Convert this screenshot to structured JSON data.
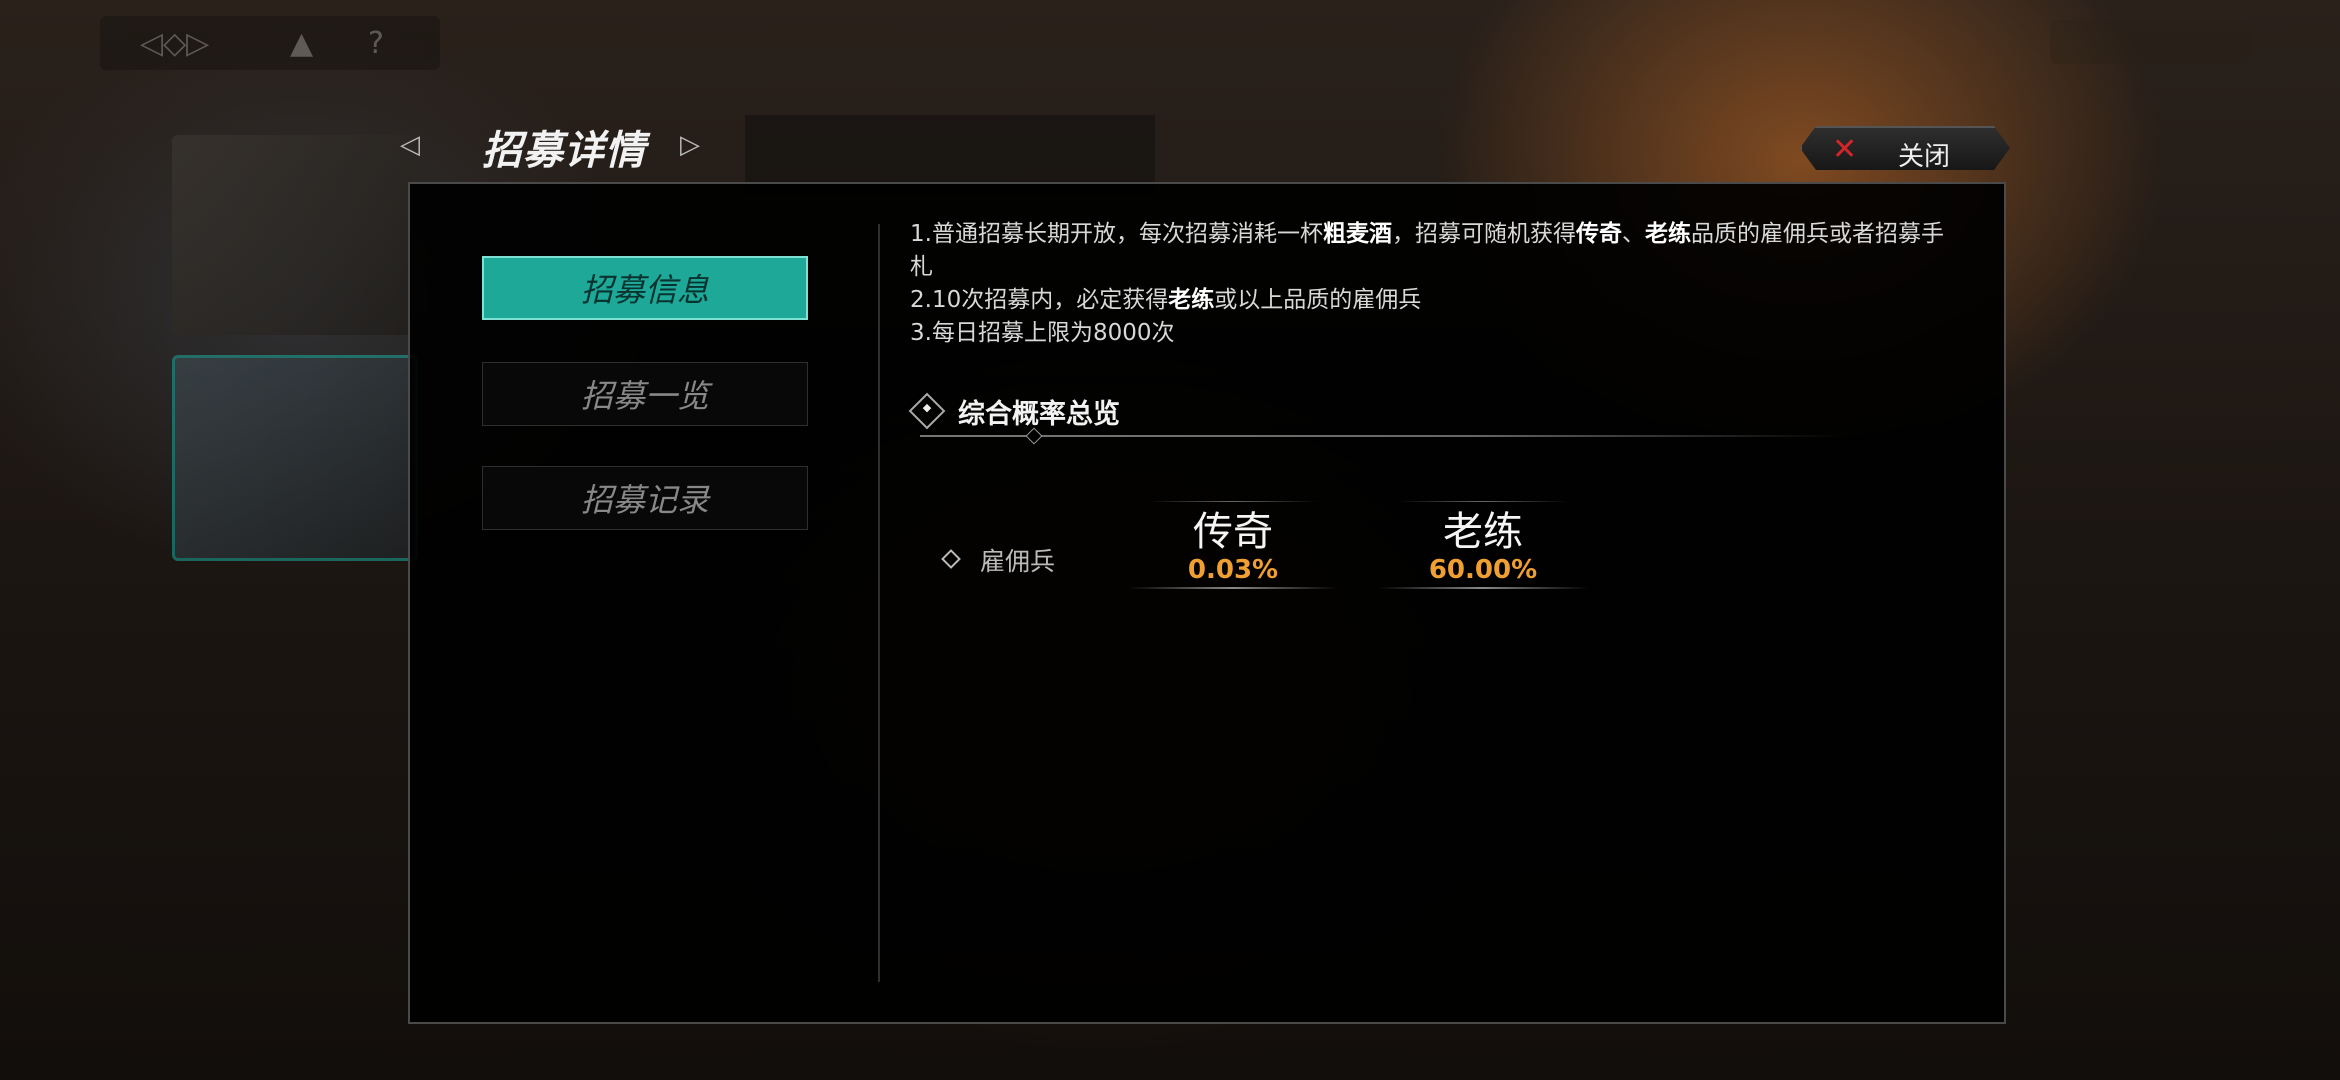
{
  "header": {
    "title": "招募详情",
    "close_label": "关闭"
  },
  "sidebar": {
    "items": [
      {
        "label": "招募信息",
        "active": true
      },
      {
        "label": "招募一览",
        "active": false
      },
      {
        "label": "招募记录",
        "active": false
      }
    ]
  },
  "description": {
    "line1_parts": [
      "1.普通招募长期开放，每次招募消耗一杯",
      "粗麦酒",
      "，招募可随机获得",
      "传奇",
      "、",
      "老练",
      "品质的雇佣兵或者招募手札"
    ],
    "line2_parts": [
      "2.10次招募内，必定获得",
      "老练",
      "或以上品质的雇佣兵"
    ],
    "line3": "3.每日招募上限为8000次"
  },
  "section": {
    "title": "综合概率总览",
    "row_label": "雇佣兵",
    "rates": [
      {
        "name": "传奇",
        "value": "0.03%"
      },
      {
        "name": "老练",
        "value": "60.00%"
      }
    ]
  },
  "colors": {
    "accent": "#1da898",
    "rate_value": "#f0a030",
    "close_x": "#d4262a"
  }
}
